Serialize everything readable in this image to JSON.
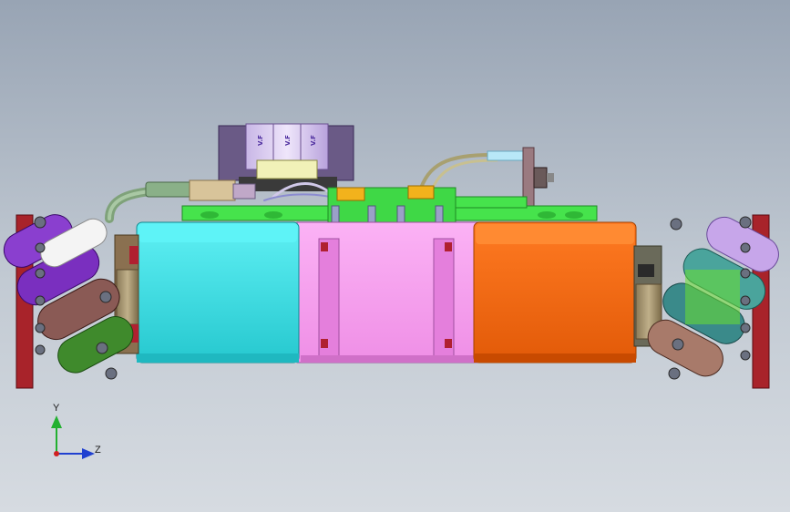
{
  "viewport": {
    "background_top": "#98a4b4",
    "background_bottom": "#d6dbe1"
  },
  "triad": {
    "y_label": "Y",
    "z_label": "Z",
    "y_color": "#22b030",
    "z_color": "#2040d0",
    "origin_color": "#d02020"
  },
  "capacitors": {
    "labels": [
      "V.F",
      "V.F",
      "V.F"
    ]
  },
  "colors": {
    "left_motor": "#39e1e6",
    "right_motor": "#f46a14",
    "center_block": "#f79cf0",
    "top_plate": "#46e34c",
    "wheel_purple": "#8a3fcf",
    "wheel_white": "#f4f4f4",
    "wheel_brown": "#8a5a55",
    "wheel_olive": "#3f8a2c",
    "wheel_teal": "#4aa49c",
    "wheel_lavender": "#c7a6ea",
    "hub_red": "#a8232a"
  }
}
